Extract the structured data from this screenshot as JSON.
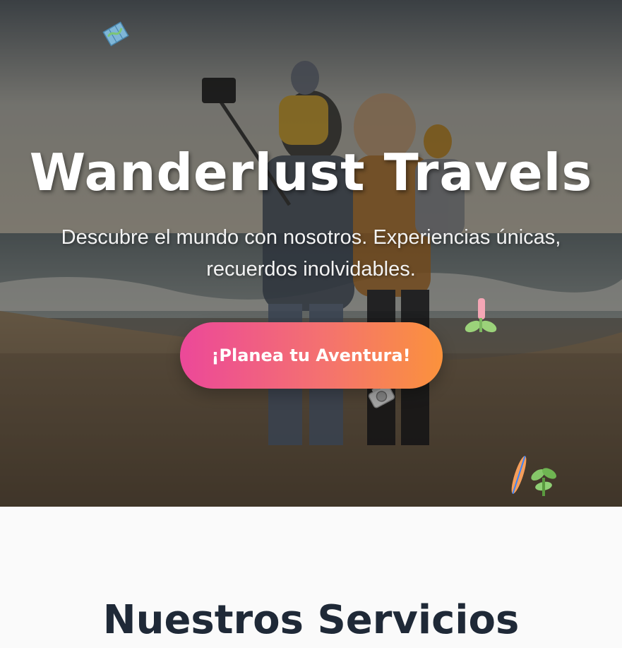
{
  "hero": {
    "title": "Wanderlust Travels",
    "subtitle": "Descubre el mundo con nosotros. Experiencias únicas, recuerdos inolvidables.",
    "cta_label": "¡Planea tu Aventura!",
    "floating_icons": [
      "map-icon",
      "flower-icon",
      "camera-icon",
      "surfboard-icon",
      "plant-icon"
    ]
  },
  "services": {
    "heading": "Nuestros Servicios"
  },
  "colors": {
    "cta_gradient_start": "#ec4899",
    "cta_gradient_end": "#fb923c",
    "heading": "#1f2937"
  }
}
